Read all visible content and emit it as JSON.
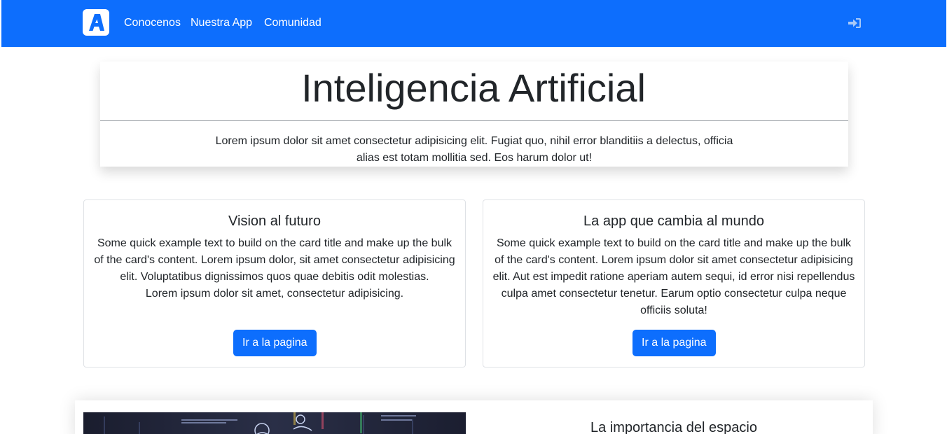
{
  "navbar": {
    "brand_letter": "A",
    "links": [
      "Conocenos",
      "Nuestra App",
      "Comunidad"
    ],
    "login_icon": "sign-in-icon",
    "colors": {
      "background": "#0d6efd",
      "text": "#ffffff",
      "login_icon": "#a9c9f7"
    }
  },
  "hero": {
    "title": "Inteligencia Artificial",
    "text_line1": "Lorem ipsum dolor sit amet consectetur adipisicing elit. Fugiat quo, nihil error blanditiis a delectus, officia",
    "text_line2": "alias est totam mollitia sed. Eos harum dolor ut!"
  },
  "cards": [
    {
      "title": "Vision al futuro",
      "text": "Some quick example text to build on the card title and make up the bulk of the card's content. Lorem ipsum dolor, sit amet consectetur adipisicing elit. Voluptatibus dignissimos quos quae debitis odit molestias.",
      "text2": "Lorem ipsum dolor sit amet, consectetur adipisicing.",
      "button": "Ir a la pagina"
    },
    {
      "title": "La app que cambia al mundo",
      "text": "Some quick example text to build on the card title and make up the bulk of the card's content. Lorem ipsum dolor sit amet consectetur adipisicing elit. Aut est impedit ratione aperiam autem sequi, id error nisi repellendus culpa amet consectetur tenetur. Earum optio consectetur culpa neque officiis soluta!",
      "button": "Ir a la pagina"
    }
  ],
  "feature": {
    "title": "La importancia del espacio",
    "image_icon": "ai-technology-image"
  },
  "theme": {
    "primary": "#0d6efd",
    "card_border": "#dfe2e6",
    "text": "#212529"
  }
}
